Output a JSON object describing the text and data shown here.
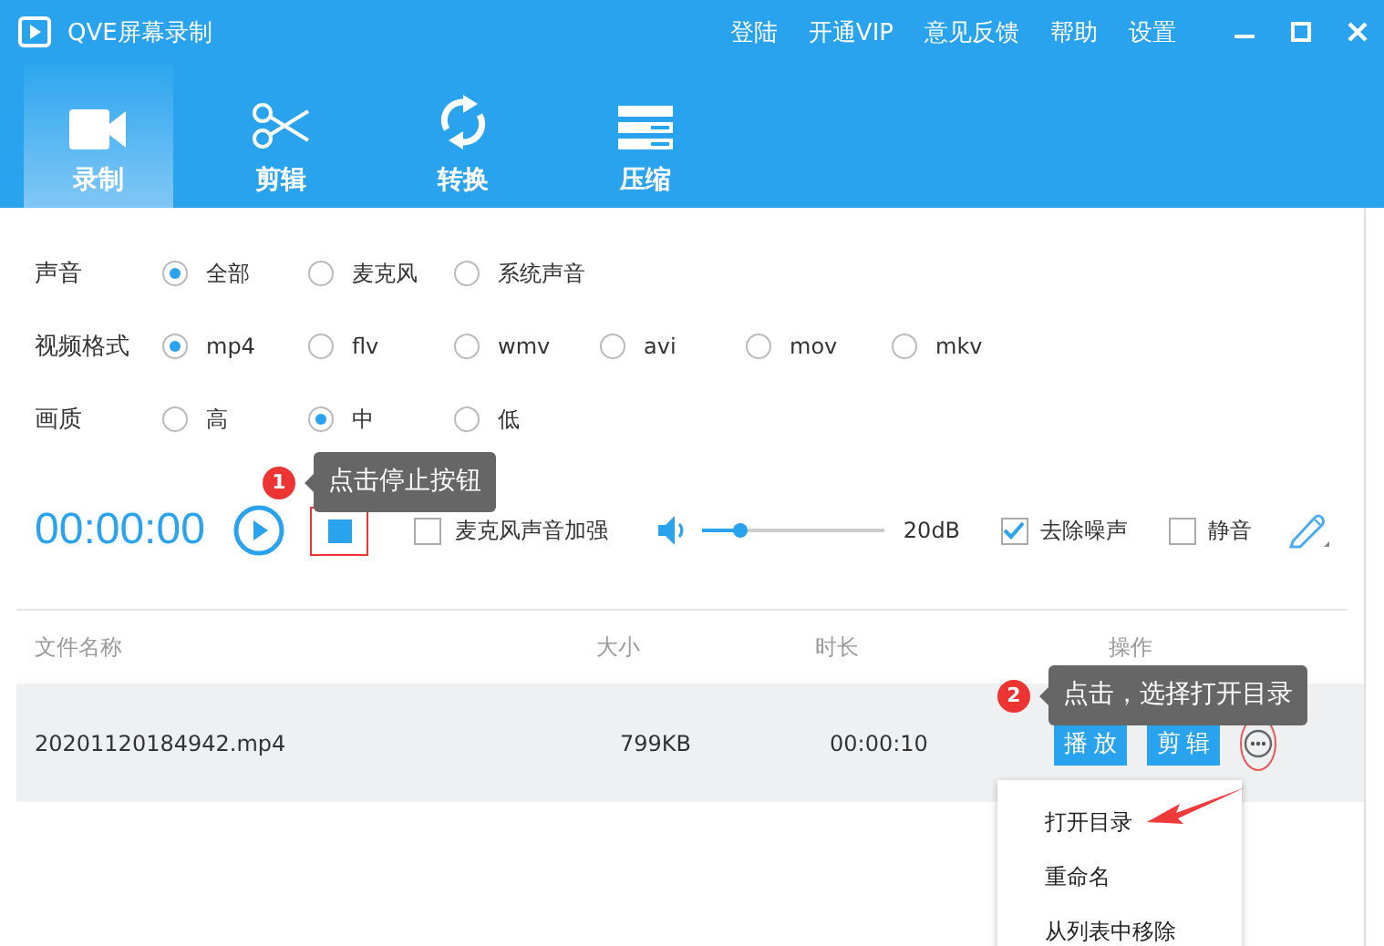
{
  "window": {
    "title": "QVE屏幕录制"
  },
  "top_links": [
    "登陆",
    "开通VIP",
    "意见反馈",
    "帮助",
    "设置"
  ],
  "tabs": [
    {
      "label": "录制",
      "selected": true
    },
    {
      "label": "剪辑",
      "selected": false
    },
    {
      "label": "转换",
      "selected": false
    },
    {
      "label": "压缩",
      "selected": false
    }
  ],
  "settings": [
    {
      "label": "声音",
      "options": [
        {
          "label": "全部",
          "selected": true
        },
        {
          "label": "麦克风",
          "selected": false
        },
        {
          "label": "系统声音",
          "selected": false
        }
      ]
    },
    {
      "label": "视频格式",
      "options": [
        {
          "label": "mp4",
          "selected": true
        },
        {
          "label": "flv",
          "selected": false
        },
        {
          "label": "wmv",
          "selected": false
        },
        {
          "label": "avi",
          "selected": false
        },
        {
          "label": "mov",
          "selected": false
        },
        {
          "label": "mkv",
          "selected": false
        }
      ]
    },
    {
      "label": "画质",
      "options": [
        {
          "label": "高",
          "selected": false
        },
        {
          "label": "中",
          "selected": true
        },
        {
          "label": "低",
          "selected": false
        }
      ]
    }
  ],
  "recorder": {
    "time": "00:00:00",
    "mic_boost": {
      "label": "麦克风声音加强",
      "checked": false
    },
    "volume": {
      "level": 0.21,
      "reading": "20dB"
    },
    "denoise": {
      "label": "去除噪声",
      "checked": true
    },
    "mute": {
      "label": "静音",
      "checked": false
    }
  },
  "table": {
    "columns": [
      "文件名称",
      "大小",
      "时长",
      "操作"
    ],
    "rows": [
      {
        "name": "20201120184942.mp4",
        "size": "799KB",
        "duration": "00:00:10",
        "actions": [
          "播放",
          "剪辑"
        ]
      }
    ]
  },
  "context_menu": [
    "打开目录",
    "重命名",
    "从列表中移除"
  ],
  "callouts": [
    {
      "number": "1",
      "text": "点击停止按钮"
    },
    {
      "number": "2",
      "text": "点击，选择打开目录"
    }
  ]
}
